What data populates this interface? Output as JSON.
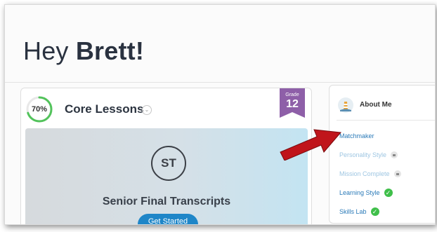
{
  "greeting": {
    "prefix": "Hey ",
    "name": "Brett!"
  },
  "core_lessons": {
    "progress_label": "70%",
    "progress_fraction": 0.7,
    "title": "Core Lessons",
    "grade_label": "Grade",
    "grade_value": "12",
    "current_lesson": {
      "avatar_initials": "ST",
      "title": "Senior Final Transcripts",
      "button_label": "Get Started"
    }
  },
  "about_me": {
    "title": "About Me",
    "items": [
      {
        "label": "Matchmaker",
        "state": "active"
      },
      {
        "label": "Personality Style",
        "state": "locked"
      },
      {
        "label": "Mission Complete",
        "state": "locked"
      },
      {
        "label": "Learning Style",
        "state": "complete"
      },
      {
        "label": "Skills Lab",
        "state": "complete"
      }
    ]
  },
  "colors": {
    "progress_ring": "#52c35b",
    "grade_badge": "#8e5fa8",
    "link_blue": "#2a7ab8",
    "locked_blue": "#9ec6e2",
    "check_green": "#3fbf4a",
    "button_blue": "#1f86c8",
    "annotation_arrow": "#c0151b"
  },
  "icons": [
    "chevron-down-icon",
    "lock-icon",
    "check-circle-icon",
    "lighthouse-icon",
    "annotation-arrow"
  ]
}
